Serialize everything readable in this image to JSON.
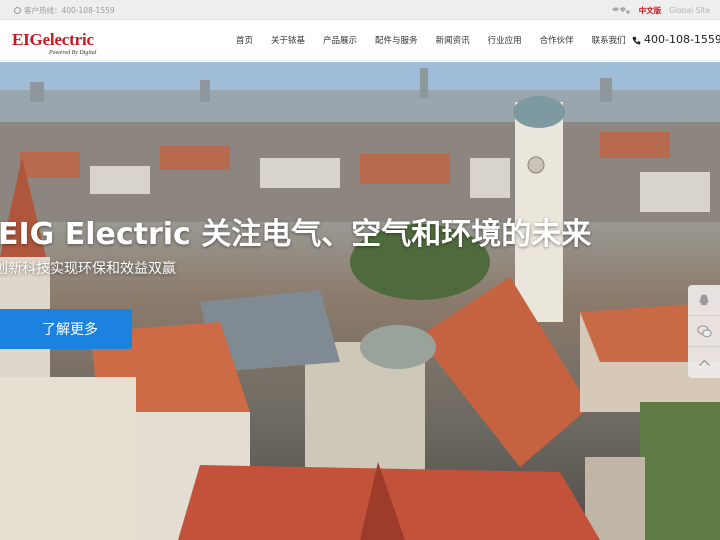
{
  "topbar": {
    "hotline": "客户热线：400-108-1559",
    "lang_cn": "中文版",
    "lang_en": "Global Site"
  },
  "header": {
    "logo_text": "EIGelectric",
    "logo_tagline": "Powered By Digital",
    "nav": [
      "首页",
      "关于铱基",
      "产品展示",
      "配件与服务",
      "新闻资讯",
      "行业应用",
      "合作伙伴",
      "联系我们"
    ],
    "phone": "400-108-1559"
  },
  "hero": {
    "headline": "EIG Electric 关注电气、空气和环境的未来",
    "subline": "创新科技实现环保和效益双赢",
    "cta": "了解更多"
  },
  "side_widgets": [
    "qq-icon",
    "wechat-icon",
    "back-to-top-icon"
  ],
  "colors": {
    "brand_red": "#c8171e",
    "cta_blue": "#1b82e0"
  }
}
